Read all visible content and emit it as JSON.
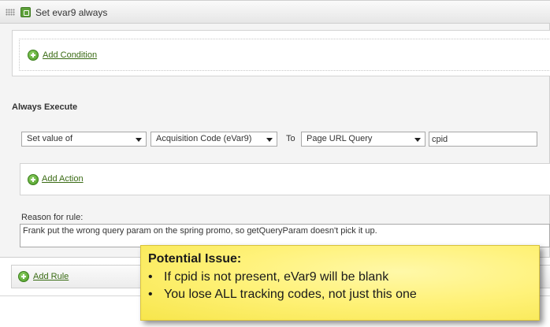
{
  "rule": {
    "title": "Set evar9 always",
    "add_condition_label": "Add Condition",
    "always_execute_label": "Always Execute",
    "action": {
      "operation": "Set value of",
      "variable": "Acquisition Code (eVar9)",
      "to_label": "To",
      "source": "Page URL Query",
      "parameter": "cpid"
    },
    "add_action_label": "Add Action",
    "reason_label": "Reason for rule:",
    "reason_text": "Frank put the wrong query param on the spring promo, so getQueryParam doesn't pick it up."
  },
  "add_rule_label": "Add Rule",
  "callout": {
    "title": "Potential Issue:",
    "bullet_glyph": "•",
    "items": [
      "If cpid is not present, eVar9 will be blank",
      "You lose ALL tracking codes, not just this one"
    ]
  },
  "colors": {
    "link_green": "#3a6b14",
    "callout_yellow": "#fff27a"
  }
}
